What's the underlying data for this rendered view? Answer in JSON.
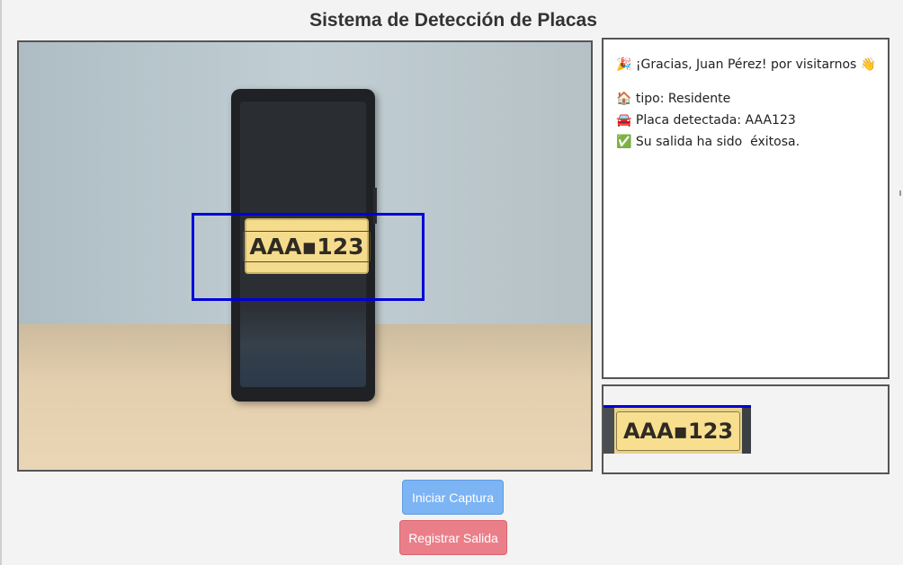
{
  "header": {
    "title": "Sistema de Detección de Placas"
  },
  "camera": {
    "plate_text": "AAA▪123"
  },
  "info": {
    "thanks": "🎉 ¡Gracias, Juan Pérez! por visitarnos 👋",
    "type": "🏠 tipo: Residente",
    "plate": "🚘 Placa detectada: AAA123",
    "result": "✅ Su salida ha sido  éxitosa."
  },
  "crop": {
    "plate_text": "AAA▪123"
  },
  "buttons": {
    "start_label": "Iniciar Captura",
    "exit_label": "Registrar Salida"
  },
  "colors": {
    "detection_box": "#0000d8",
    "start_button": "#7cb4f4",
    "exit_button": "#ea7f8a"
  }
}
